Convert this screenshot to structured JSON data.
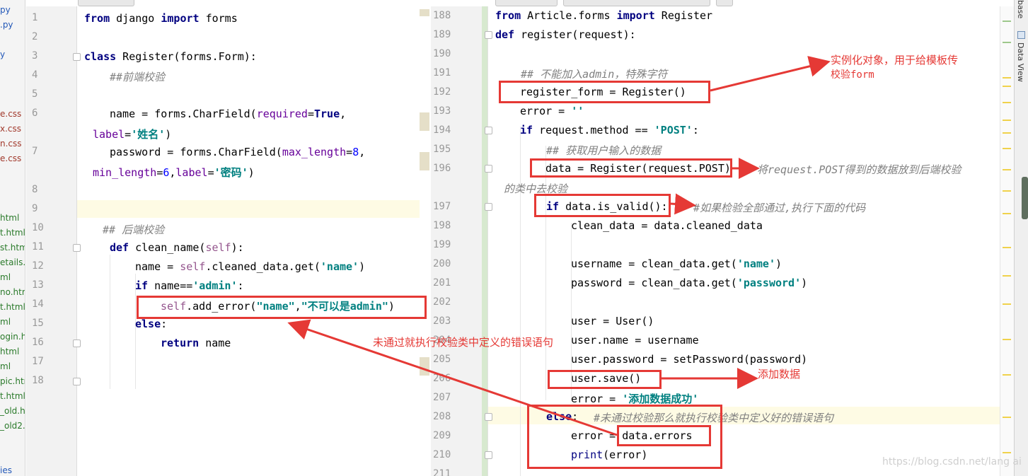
{
  "project_files": [
    "py",
    ".py",
    "",
    "y",
    "",
    "",
    "",
    "e.css",
    "x.css",
    "n.css",
    "e.css",
    "",
    "",
    "",
    "html",
    "t.html",
    "st.htm",
    "etails.l",
    "ml",
    "no.htm",
    "t.html",
    "ml",
    "ogin.ht",
    "html",
    "ml",
    "pic.htm",
    "t.html",
    "_old.h",
    "_old2.",
    "",
    "",
    "ies"
  ],
  "left_editor": {
    "line_numbers": [
      "1",
      "2",
      "3",
      "4",
      "5",
      "6",
      "7",
      "8",
      "9",
      "10",
      "11",
      "12",
      "13",
      "14",
      "15",
      "16",
      "17",
      "18"
    ],
    "lines": {
      "l1_kw1": "from",
      "l1_mod": " django ",
      "l1_kw2": "import",
      "l1_name": " forms",
      "l3_kw": "class",
      "l3_name": " Register",
      "l3_p1": "(forms.Form):",
      "l4_cmt": "##前端校验",
      "l6_a": "name = forms.CharField(",
      "l6_param": "required",
      "l6_eq": "=",
      "l6_true": "True",
      "l6_comma": ",",
      "l6b_param": "label",
      "l6b_eq": "=",
      "l6b_str": "'姓名'",
      "l6b_end": ")",
      "l7_a": "password = forms.CharField(",
      "l7_param": "max_length",
      "l7_eq": "=",
      "l7_num": "8",
      "l7_comma": ",",
      "l7b_param1": "min_length",
      "l7b_eq1": "=",
      "l7b_num": "6",
      "l7b_comma": ",",
      "l7b_param2": "label",
      "l7b_eq2": "=",
      "l7b_str": "'密码'",
      "l7b_end": ")",
      "l10_cmt": "## 后端校验",
      "l11_kw": "def",
      "l11_name": " clean_name(",
      "l11_self": "self",
      "l11_end": "):",
      "l12_a": "name = ",
      "l12_self": "self",
      "l12_b": ".cleaned_data.get(",
      "l12_str": "'name'",
      "l12_end": ")",
      "l13_kw": "if",
      "l13_a": " name==",
      "l13_str": "'admin'",
      "l13_end": ":",
      "l14_self": "self",
      "l14_a": ".add_error(",
      "l14_str1": "\"name\"",
      "l14_comma": ",",
      "l14_str2": "\"不可以是admin\"",
      "l14_end": ")",
      "l15_kw": "else",
      "l15_end": ":",
      "l16_kw": "return",
      "l16_name": " name"
    }
  },
  "right_editor": {
    "line_numbers": [
      "188",
      "189",
      "190",
      "191",
      "192",
      "193",
      "194",
      "195",
      "196",
      "",
      "197",
      "198",
      "199",
      "200",
      "201",
      "202",
      "203",
      "204",
      "205",
      "206",
      "207",
      "208",
      "209",
      "210",
      "211"
    ],
    "lines": {
      "r188_kw1": "from",
      "r188_mod": " Article.forms ",
      "r188_kw2": "import",
      "r188_name": " Register",
      "r189_kw": "def",
      "r189_name": " register(request):",
      "r191_cmt": "## 不能加入admin，特殊字符",
      "r192": "register_form = Register()",
      "r193_a": "error = ",
      "r193_str": "''",
      "r194_kw": "if",
      "r194_a": " request.method == ",
      "r194_str": "'POST'",
      "r194_end": ":",
      "r195_cmt": "## 获取用户输入的数据",
      "r196": "data = Register(request.POST)",
      "r197_kw": "if",
      "r197_a": " data.is_valid():",
      "r198": "clean_data = data.cleaned_data",
      "r200_a": "username = clean_data.get(",
      "r200_str": "'name'",
      "r200_end": ")",
      "r201_a": "password = clean_data.get(",
      "r201_str": "'password'",
      "r201_end": ")",
      "r203": "user = User()",
      "r204": "user.name = username",
      "r205": "user.password = setPassword(password)",
      "r206": "user.save()",
      "r207_a": "error = ",
      "r207_str": "'添加数据成功'",
      "r208_kw": "else",
      "r208_end": ":",
      "r208_cmt": "#未通过校验那么就执行校验类中定义好的错误语句",
      "r209_a": "error = ",
      "r209_b": "data.errors",
      "r210_a": "print",
      "r210_b": "(error)"
    }
  },
  "annotations": {
    "instantiate_1": "实例化对象，用于给模板传",
    "instantiate_2": "校验form",
    "post_1": "将request.POST得到的数据放到后端校验",
    "post_2": "的类中去校验",
    "valid": "#如果检验全部通过,执行下面的代码",
    "add_error": "未通过就执行校验类中定义的错误语句",
    "save": "添加数据"
  },
  "side_panel": {
    "top_label": "base",
    "data_view": "Data View"
  },
  "watermark": "https://blog.csdn.net/lang  ai",
  "colors": {
    "annotation_red": "#e53935",
    "keyword": "#000080",
    "string": "#008080",
    "comment": "#808080",
    "self": "#94558d",
    "number": "#0000ff"
  }
}
